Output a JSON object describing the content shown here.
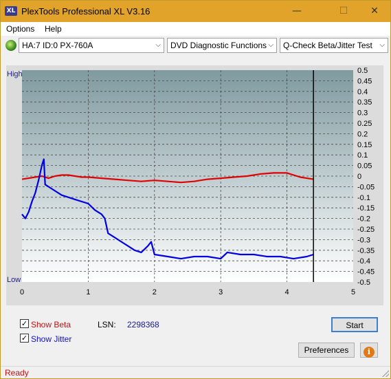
{
  "window": {
    "title": "PlexTools Professional XL V3.16",
    "icon_text": "XL",
    "min_glyph": "—",
    "max_glyph": "☐",
    "close_glyph": "✕"
  },
  "menu": {
    "options": "Options",
    "help": "Help"
  },
  "toolbar": {
    "drive": "HA:7 ID:0  PX-760A",
    "function": "DVD Diagnostic Functions",
    "test": "Q-Check Beta/Jitter Test",
    "arrow": "⌵"
  },
  "chart_labels": {
    "high": "High",
    "low": "Low"
  },
  "chart_data": {
    "type": "line",
    "xlim": [
      0,
      5
    ],
    "x_ticks": [
      "0",
      "1",
      "2",
      "3",
      "4",
      "5"
    ],
    "ylim": [
      -0.5,
      0.5
    ],
    "y_ticks": [
      "0.5",
      "0.45",
      "0.4",
      "0.35",
      "0.3",
      "0.25",
      "0.2",
      "0.15",
      "0.1",
      "0.05",
      "0",
      "-0.05",
      "-0.1",
      "-0.15",
      "-0.2",
      "-0.25",
      "-0.3",
      "-0.35",
      "-0.4",
      "-0.45",
      "-0.5"
    ],
    "marker_x": 4.4,
    "grid": true,
    "series": [
      {
        "color": "#e00000",
        "points": [
          [
            0,
            -0.015
          ],
          [
            0.1,
            -0.01
          ],
          [
            0.2,
            -0.005
          ],
          [
            0.3,
            0.0
          ],
          [
            0.4,
            -0.01
          ],
          [
            0.5,
            0.0
          ],
          [
            0.6,
            0.005
          ],
          [
            0.7,
            0.005
          ],
          [
            0.8,
            0.0
          ],
          [
            0.9,
            -0.005
          ],
          [
            1.0,
            -0.005
          ],
          [
            1.2,
            -0.01
          ],
          [
            1.4,
            -0.015
          ],
          [
            1.6,
            -0.02
          ],
          [
            1.8,
            -0.025
          ],
          [
            2.0,
            -0.02
          ],
          [
            2.2,
            -0.025
          ],
          [
            2.4,
            -0.03
          ],
          [
            2.6,
            -0.025
          ],
          [
            2.8,
            -0.015
          ],
          [
            3.0,
            -0.01
          ],
          [
            3.2,
            -0.005
          ],
          [
            3.4,
            0.0
          ],
          [
            3.6,
            0.01
          ],
          [
            3.8,
            0.015
          ],
          [
            4.0,
            0.015
          ],
          [
            4.1,
            0.005
          ],
          [
            4.2,
            -0.005
          ],
          [
            4.3,
            -0.01
          ],
          [
            4.4,
            -0.015
          ]
        ]
      },
      {
        "color": "#0000e0",
        "points": [
          [
            0,
            -0.18
          ],
          [
            0.05,
            -0.2
          ],
          [
            0.1,
            -0.17
          ],
          [
            0.15,
            -0.12
          ],
          [
            0.2,
            -0.08
          ],
          [
            0.25,
            -0.02
          ],
          [
            0.3,
            0.05
          ],
          [
            0.33,
            0.08
          ],
          [
            0.35,
            -0.04
          ],
          [
            0.45,
            -0.06
          ],
          [
            0.6,
            -0.09
          ],
          [
            0.8,
            -0.11
          ],
          [
            1.0,
            -0.13
          ],
          [
            1.1,
            -0.16
          ],
          [
            1.2,
            -0.18
          ],
          [
            1.25,
            -0.2
          ],
          [
            1.3,
            -0.27
          ],
          [
            1.4,
            -0.29
          ],
          [
            1.5,
            -0.31
          ],
          [
            1.6,
            -0.33
          ],
          [
            1.7,
            -0.35
          ],
          [
            1.8,
            -0.36
          ],
          [
            1.9,
            -0.33
          ],
          [
            1.95,
            -0.31
          ],
          [
            2.0,
            -0.37
          ],
          [
            2.2,
            -0.38
          ],
          [
            2.4,
            -0.39
          ],
          [
            2.6,
            -0.38
          ],
          [
            2.8,
            -0.38
          ],
          [
            3.0,
            -0.39
          ],
          [
            3.1,
            -0.36
          ],
          [
            3.3,
            -0.37
          ],
          [
            3.5,
            -0.37
          ],
          [
            3.7,
            -0.38
          ],
          [
            3.9,
            -0.38
          ],
          [
            4.1,
            -0.39
          ],
          [
            4.3,
            -0.38
          ],
          [
            4.4,
            -0.37
          ]
        ]
      }
    ]
  },
  "controls": {
    "show_beta": "Show Beta",
    "show_jitter": "Show Jitter",
    "beta_checked": true,
    "jitter_checked": true,
    "lsn_label": "LSN:",
    "lsn_value": "2298368",
    "start": "Start",
    "preferences": "Preferences",
    "info_glyph": "i",
    "check_glyph": "✓"
  },
  "status": {
    "text": "Ready"
  },
  "colors": {
    "title_bar": "#e1a32a",
    "beta": "#e00000",
    "jitter": "#0000e0",
    "plot_top": "#7f9aa0",
    "plot_bottom": "#ffffff"
  }
}
